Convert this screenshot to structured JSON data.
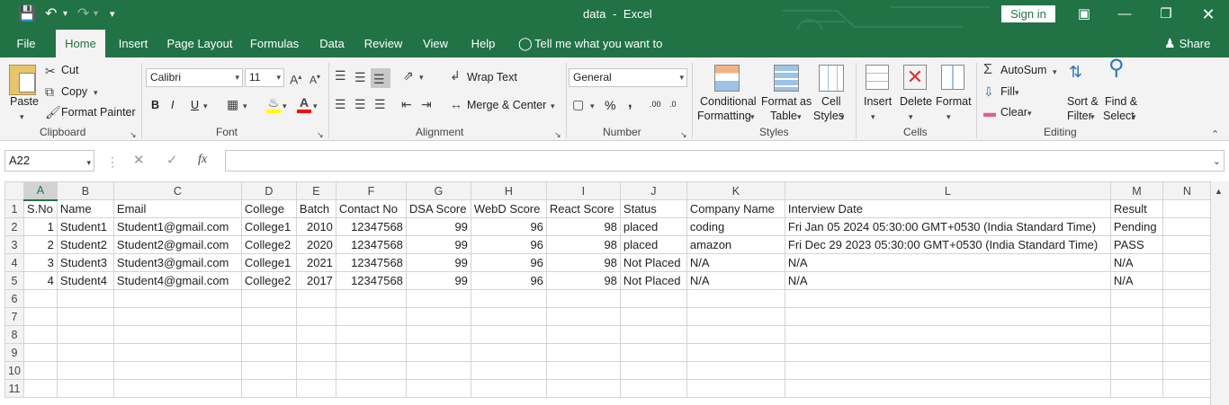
{
  "title": {
    "doc": "data",
    "sep": "-",
    "app": "Excel",
    "signin": "Sign in"
  },
  "tabs": [
    "File",
    "Home",
    "Insert",
    "Page Layout",
    "Formulas",
    "Data",
    "Review",
    "View",
    "Help"
  ],
  "tellme": "Tell me what you want to do",
  "share": "Share",
  "clipboard": {
    "paste": "Paste",
    "cut": "Cut",
    "copy": "Copy",
    "painter": "Format Painter",
    "group": "Clipboard"
  },
  "font": {
    "name": "Calibri",
    "size": "11",
    "bold": "B",
    "italic": "I",
    "underline": "U",
    "group": "Font"
  },
  "alignment": {
    "wrap": "Wrap Text",
    "merge": "Merge & Center",
    "group": "Alignment"
  },
  "number": {
    "format": "General",
    "percent": "%",
    "comma": ",",
    "inc": ".00",
    "dec": ".0",
    "group": "Number"
  },
  "styles": {
    "cond1": "Conditional",
    "cond2": "Formatting",
    "fmt1": "Format as",
    "fmt2": "Table",
    "cell1": "Cell",
    "cell2": "Styles",
    "group": "Styles"
  },
  "cells": {
    "insert": "Insert",
    "delete": "Delete",
    "format": "Format",
    "group": "Cells"
  },
  "editing": {
    "autosum": "AutoSum",
    "fill": "Fill",
    "clear": "Clear",
    "sort1": "Sort &",
    "sort2": "Filter",
    "find1": "Find &",
    "find2": "Select",
    "group": "Editing"
  },
  "namebox": "A22",
  "fx": "fx",
  "columns": [
    "A",
    "B",
    "C",
    "D",
    "E",
    "F",
    "G",
    "H",
    "I",
    "J",
    "K",
    "L",
    "M",
    "N"
  ],
  "rows": [
    [
      "1",
      "S.No",
      "Name",
      "Email",
      "College",
      "Batch",
      "Contact No",
      "DSA Score",
      "WebD Score",
      "React Score",
      "Status",
      "Company Name",
      "Interview Date",
      "Result",
      ""
    ],
    [
      "2",
      "1",
      "Student1",
      "Student1@gmail.com",
      "College1",
      "2010",
      "12347568",
      "99",
      "96",
      "98",
      "placed",
      "coding",
      "Fri Jan 05 2024 05:30:00 GMT+0530 (India Standard Time)",
      "Pending",
      ""
    ],
    [
      "3",
      "2",
      "Student2",
      "Student2@gmail.com",
      "College2",
      "2020",
      "12347568",
      "99",
      "96",
      "98",
      "placed",
      "amazon",
      "Fri Dec 29 2023 05:30:00 GMT+0530 (India Standard Time)",
      "PASS",
      ""
    ],
    [
      "4",
      "3",
      "Student3",
      "Student3@gmail.com",
      "College1",
      "2021",
      "12347568",
      "99",
      "96",
      "98",
      "Not Placed",
      "N/A",
      "N/A",
      "N/A",
      ""
    ],
    [
      "5",
      "4",
      "Student4",
      "Student4@gmail.com",
      "College2",
      "2017",
      "12347568",
      "99",
      "96",
      "98",
      "Not Placed",
      "N/A",
      "N/A",
      "N/A",
      ""
    ],
    [
      "6",
      "",
      "",
      "",
      "",
      "",
      "",
      "",
      "",
      "",
      "",
      "",
      "",
      "",
      ""
    ],
    [
      "7",
      "",
      "",
      "",
      "",
      "",
      "",
      "",
      "",
      "",
      "",
      "",
      "",
      "",
      ""
    ],
    [
      "8",
      "",
      "",
      "",
      "",
      "",
      "",
      "",
      "",
      "",
      "",
      "",
      "",
      "",
      ""
    ],
    [
      "9",
      "",
      "",
      "",
      "",
      "",
      "",
      "",
      "",
      "",
      "",
      "",
      "",
      "",
      ""
    ],
    [
      "10",
      "",
      "",
      "",
      "",
      "",
      "",
      "",
      "",
      "",
      "",
      "",
      "",
      "",
      ""
    ],
    [
      "11",
      "",
      "",
      "",
      "",
      "",
      "",
      "",
      "",
      "",
      "",
      "",
      "",
      "",
      ""
    ]
  ]
}
